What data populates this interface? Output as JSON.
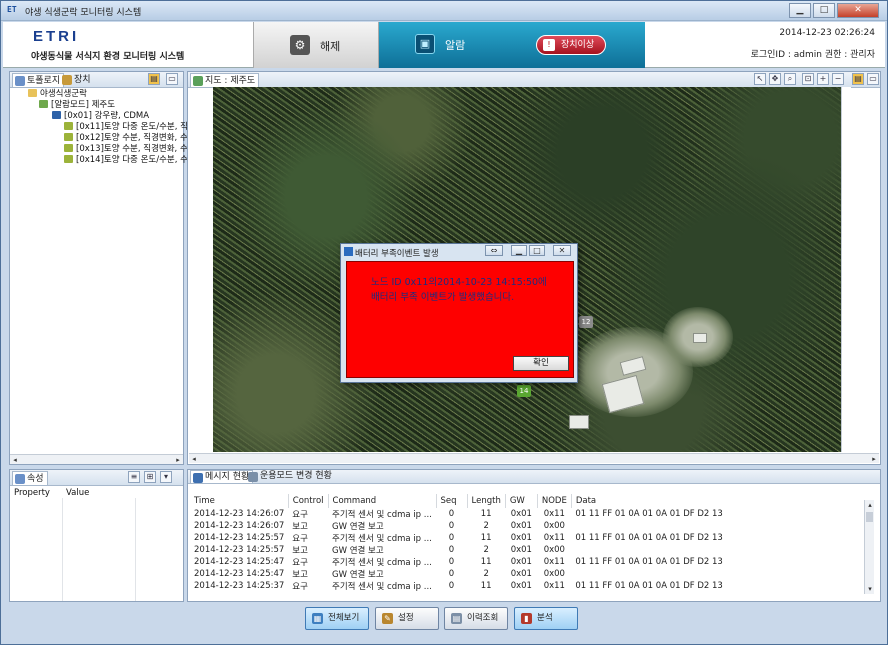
{
  "window": {
    "title": "야생 식생군락 모니터링 시스템",
    "app_icon": "ET"
  },
  "header": {
    "logo": "ETRI",
    "subtitle": "야생동식물 서식지 환경 모니터링 시스템",
    "release_label": "해제",
    "alarm_label": "알람",
    "device_status_label": "장치이상",
    "datetime": "2014-12-23 02:26:24",
    "login_info": "로그인ID : admin 권한 : 관리자"
  },
  "left_panel": {
    "tabs": [
      "토폴로지",
      "장치"
    ],
    "tree": [
      {
        "label": "야생식생군락",
        "level": 0,
        "icon": "folder-icon"
      },
      {
        "label": "[알람모드] 제주도",
        "level": 1,
        "icon": "region-icon"
      },
      {
        "label": "[0x01] 강우량, CDMA",
        "level": 2,
        "icon": "gateway-icon"
      },
      {
        "label": "[0x11]토양 다중 온도/수분, 직",
        "level": 3,
        "icon": "sensor-icon"
      },
      {
        "label": "[0x12]토양 수분, 직경변화, 수",
        "level": 3,
        "icon": "sensor-icon"
      },
      {
        "label": "[0x13]토양 수분, 직경변화, 수",
        "level": 3,
        "icon": "sensor-icon"
      },
      {
        "label": "[0x14]토양 다중 온도/수분, 수",
        "level": 3,
        "icon": "sensor-icon"
      }
    ]
  },
  "properties_panel": {
    "tab": "속성",
    "columns": [
      "Property",
      "Value"
    ]
  },
  "map_panel": {
    "tab": "지도 : 제주도",
    "markers": [
      "12",
      "14"
    ]
  },
  "dialog": {
    "title": "배터리 부족이벤트 발생",
    "message_line1": "노드 ID 0x11의2014-10-23 14:15:50에",
    "message_line2": "배터리 부족 이벤트가 발생했습니다.",
    "ok_label": "확인"
  },
  "log_panel": {
    "tabs": [
      "메시지 현황",
      "운용모드 변경 현황"
    ],
    "columns": [
      "Time",
      "Control",
      "Command",
      "Seq",
      "Length",
      "GW",
      "NODE",
      "Data"
    ],
    "rows": [
      [
        "2014-12-23 14:26:07",
        "요구",
        "주기적 센서 및 cdma ip ...",
        "0",
        "11",
        "0x01",
        "0x11",
        "01 11 FF 01 0A 01 0A 01 DF D2 13"
      ],
      [
        "2014-12-23 14:26:07",
        "보고",
        "GW 연결 보고",
        "0",
        "2",
        "0x01",
        "0x00",
        ""
      ],
      [
        "2014-12-23 14:25:57",
        "요구",
        "주기적 센서 및 cdma ip ...",
        "0",
        "11",
        "0x01",
        "0x11",
        "01 11 FF 01 0A 01 0A 01 DF D2 13"
      ],
      [
        "2014-12-23 14:25:57",
        "보고",
        "GW 연결 보고",
        "0",
        "2",
        "0x01",
        "0x00",
        ""
      ],
      [
        "2014-12-23 14:25:47",
        "요구",
        "주기적 센서 및 cdma ip ...",
        "0",
        "11",
        "0x01",
        "0x11",
        "01 11 FF 01 0A 01 0A 01 DF D2 13"
      ],
      [
        "2014-12-23 14:25:47",
        "보고",
        "GW 연결 보고",
        "0",
        "2",
        "0x01",
        "0x00",
        ""
      ],
      [
        "2014-12-23 14:25:37",
        "요구",
        "주기적 센서 및 cdma ip ...",
        "0",
        "11",
        "0x01",
        "0x11",
        "01 11 FF 01 0A 01 0A 01 DF D2 13"
      ]
    ]
  },
  "bottom_buttons": {
    "full_view": "전체보기",
    "settings": "설정",
    "history": "이력조회",
    "analysis": "분석"
  },
  "colors": {
    "alarm_panel": "#1a8fba",
    "device_alert": "#c0192a",
    "dialog_body": "#fe0000",
    "dialog_text": "#1d2d80"
  }
}
